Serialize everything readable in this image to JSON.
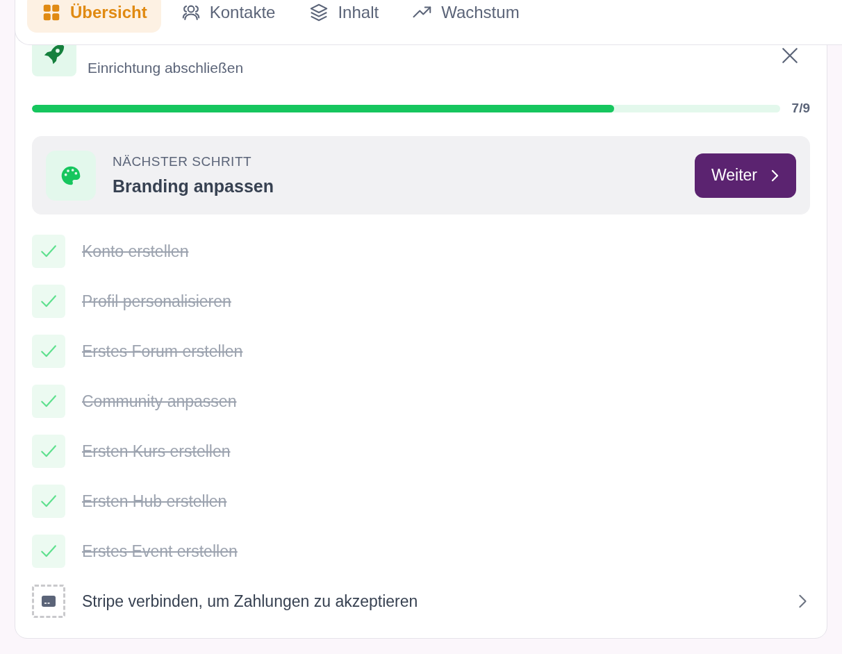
{
  "tabs": [
    {
      "label": "Übersicht",
      "selected": true
    },
    {
      "label": "Kontakte",
      "selected": false
    },
    {
      "label": "Inhalt",
      "selected": false
    },
    {
      "label": "Wachstum",
      "selected": false
    }
  ],
  "onboarding": {
    "subtitle": "Einrichtung abschließen",
    "progress": {
      "level": 0.778,
      "reading": "7/9"
    },
    "next_step": {
      "eyebrow": "NÄCHSTER SCHRITT",
      "title": "Branding anpassen",
      "button": "Weiter"
    },
    "steps": [
      {
        "label": "Konto erstellen",
        "done": true
      },
      {
        "label": "Profil personalisieren",
        "done": true
      },
      {
        "label": "Erstes Forum erstellen",
        "done": true
      },
      {
        "label": "Community anpassen",
        "done": true
      },
      {
        "label": "Ersten Kurs erstellen",
        "done": true
      },
      {
        "label": "Ersten Hub erstellen",
        "done": true
      },
      {
        "label": "Erstes Event erstellen",
        "done": true
      },
      {
        "label": "Stripe verbinden, um Zahlungen zu akzeptieren",
        "done": false
      }
    ]
  }
}
